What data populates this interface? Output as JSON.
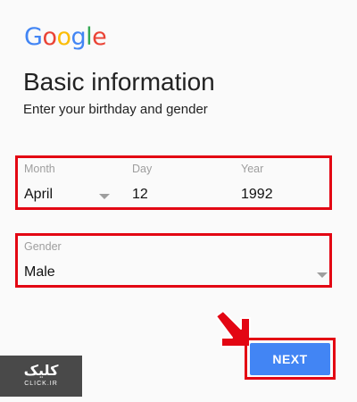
{
  "logo": {
    "text": "Google",
    "letters": [
      {
        "ch": "G",
        "color": "#4285F4"
      },
      {
        "ch": "o",
        "color": "#EA4335"
      },
      {
        "ch": "o",
        "color": "#FBBC05"
      },
      {
        "ch": "g",
        "color": "#4285F4"
      },
      {
        "ch": "l",
        "color": "#34A853"
      },
      {
        "ch": "e",
        "color": "#EA4335"
      }
    ]
  },
  "header": {
    "title": "Basic information",
    "subtitle": "Enter your birthday and gender"
  },
  "birthday": {
    "month_label": "Month",
    "month_value": "April",
    "day_label": "Day",
    "day_value": "12",
    "year_label": "Year",
    "year_value": "1992"
  },
  "gender": {
    "label": "Gender",
    "value": "Male"
  },
  "actions": {
    "next_label": "NEXT"
  },
  "watermark": {
    "main": "کلیک",
    "sub": "CLICK.IR"
  },
  "colors": {
    "accent": "#4285F4",
    "highlight": "#E30613",
    "arrow": "#E30613"
  },
  "icons": {
    "dropdown": "chevron-down-icon",
    "pointer": "arrow-pointer-icon"
  }
}
